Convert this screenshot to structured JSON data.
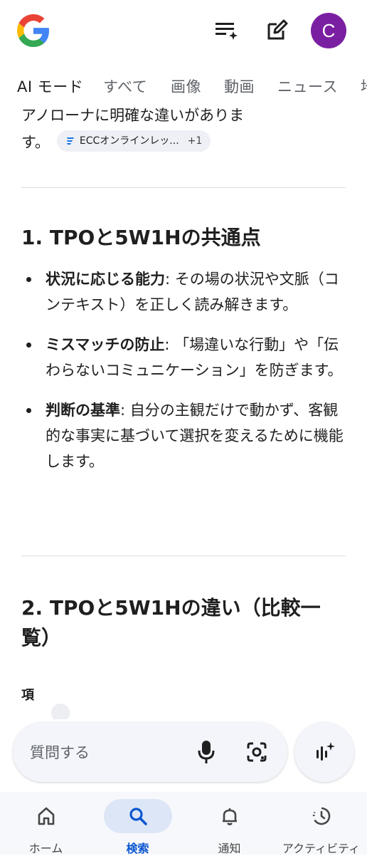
{
  "header": {
    "logo": "google-g-logo",
    "icons": [
      "task-list-sparkle-icon",
      "edit-icon"
    ],
    "avatar_letter": "C",
    "avatar_color": "#7b1fa2"
  },
  "tabs": [
    {
      "label": "AI モード",
      "active": true
    },
    {
      "label": "すべて"
    },
    {
      "label": "画像"
    },
    {
      "label": "動画"
    },
    {
      "label": "ニュース"
    },
    {
      "label": "地"
    }
  ],
  "content": {
    "intro_line1": "アノローナに明確な違いがありま",
    "intro_line2": "す。",
    "source_chip": {
      "label": "ECCオンラインレッ...",
      "extra": "+1"
    },
    "section1": {
      "title": "1. TPOと5W1Hの共通点",
      "bullets": [
        {
          "term": "状況に応じる能力",
          "text": ": その場の状況や文脈（コンテキスト）を正しく読み解きます。"
        },
        {
          "term": "ミスマッチの防止",
          "text": ": 「場違いな行動」や「伝わらないコミュニケーション」を防ぎます。"
        },
        {
          "term": "判断の基準",
          "text": ": 自分の主観だけで動かず、客観的な事実に基づいて選択を変えるために機能します。"
        }
      ]
    },
    "section2": {
      "title": "2. TPOと5W1Hの違い（比較一覧）",
      "table_header": "項"
    }
  },
  "search": {
    "placeholder": "質問する",
    "icons": [
      "microphone-icon",
      "lens-camera-icon",
      "ai-mode-sparkle-icon"
    ]
  },
  "bottom_nav": [
    {
      "label": "ホーム",
      "icon": "home-icon"
    },
    {
      "label": "検索",
      "icon": "search-icon",
      "active": true
    },
    {
      "label": "通知",
      "icon": "bell-icon"
    },
    {
      "label": "アクティビティ",
      "icon": "activity-icon"
    }
  ],
  "colors": {
    "accent": "#0b57d0",
    "active_pill": "#dde6f7"
  }
}
